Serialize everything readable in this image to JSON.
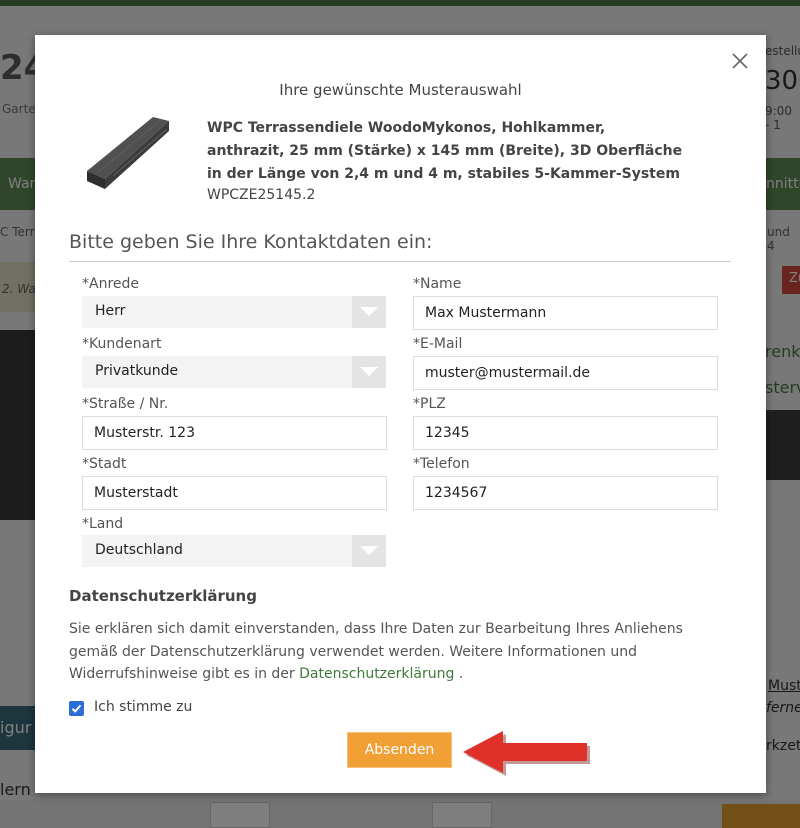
{
  "background": {
    "logo": "24",
    "logo_sub": "Garte",
    "right_top": "estellu",
    "right_number": "300",
    "right_time": "9:00 - 1",
    "nav_left": "War",
    "nav_right": "nnitth",
    "crumb_left": "C Terr",
    "crumb_right": "und 4",
    "step": "2. Wa",
    "red_btn": "Zu",
    "right_head1": "renko",
    "right_head2": "sterv",
    "blue_bar": "igur",
    "footer_left": "lern",
    "right_link1": "Must",
    "right_link2": "ferner",
    "right_link3": "rkzet"
  },
  "modal": {
    "title": "Ihre gewünschte Musterauswahl",
    "product": {
      "name": "WPC Terrassendiele WoodoMykonos, Hohlkammer, anthrazit, 25 mm (Stärke) x 145 mm (Breite), 3D Oberfläche in der Länge von 2,4 m und 4 m, stabiles 5-Kammer-System",
      "sku": "WPCZE25145.2"
    },
    "section_heading": "Bitte geben Sie Ihre Kontaktdaten ein:",
    "fields": {
      "anrede": {
        "label": "*Anrede",
        "value": "Herr"
      },
      "kundenart": {
        "label": "*Kundenart",
        "value": "Privatkunde"
      },
      "strasse": {
        "label": "*Straße / Nr.",
        "value": "Musterstr. 123"
      },
      "stadt": {
        "label": "*Stadt",
        "value": "Musterstadt"
      },
      "land": {
        "label": "*Land",
        "value": "Deutschland"
      },
      "name": {
        "label": "*Name",
        "value": "Max Mustermann"
      },
      "email": {
        "label": "*E-Mail",
        "value": "muster@mustermail.de"
      },
      "plz": {
        "label": "*PLZ",
        "value": "12345"
      },
      "telefon": {
        "label": "*Telefon",
        "value": "1234567"
      }
    },
    "privacy": {
      "heading": "Datenschutzerklärung",
      "text_before": "Sie erklären sich damit einverstanden, dass Ihre Daten zur Bearbeitung Ihres Anliehens gemäß der Datenschutzerklärung verwendet werden. Weitere Informationen und Widerrufshinweise gibt es in der ",
      "link": "Datenschutzerklärung",
      "text_after": " ."
    },
    "consent_label": "Ich stimme zu",
    "consent_checked": true,
    "submit_label": "Absenden"
  },
  "colors": {
    "accent_orange": "#f0a035",
    "checkbox_blue": "#2b6fd6",
    "link_green": "#3f7a3a",
    "arrow_red": "#e0302a"
  },
  "icons": {
    "close": "close-icon",
    "select": "chevron-down-icon",
    "checkbox": "checkmark-icon",
    "pointer": "red-arrow-icon"
  }
}
